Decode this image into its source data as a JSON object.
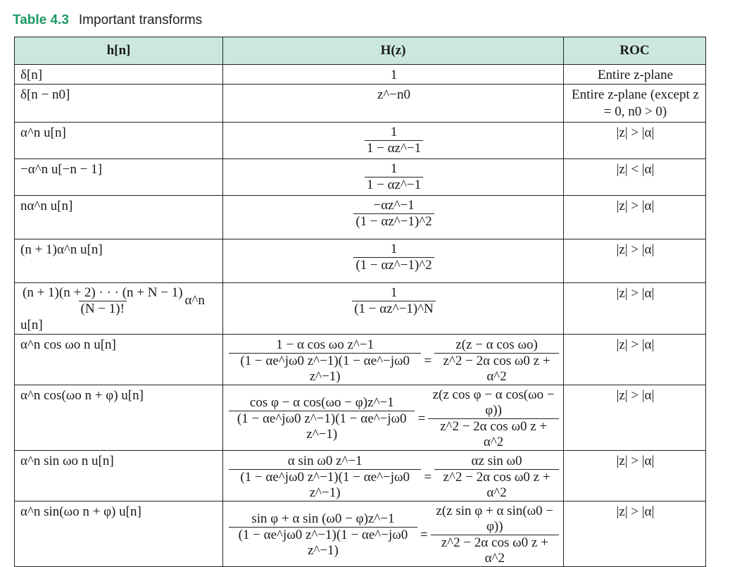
{
  "caption": {
    "number": "Table 4.3",
    "title": "Important transforms"
  },
  "headers": {
    "h": "h[n]",
    "H": "H(z)",
    "roc": "ROC"
  },
  "rows": [
    {
      "h": "δ[n]",
      "H": "1",
      "roc": "Entire z-plane"
    },
    {
      "h": "δ[n − n0]",
      "H": "z^−n0",
      "roc": "Entire z-plane (except z = 0, n0 > 0)"
    },
    {
      "h": "α^n u[n]",
      "H_num": "1",
      "H_den": "1 − αz^−1",
      "roc": "|z| > |α|"
    },
    {
      "h": "−α^n u[−n − 1]",
      "H_num": "1",
      "H_den": "1 − αz^−1",
      "roc": "|z| < |α|"
    },
    {
      "h": "nα^n u[n]",
      "H_num": "−αz^−1",
      "H_den": "(1 − αz^−1)^2",
      "roc": "|z| > |α|"
    },
    {
      "h": "(n + 1)α^n u[n]",
      "H_num": "1",
      "H_den": "(1 − αz^−1)^2",
      "roc": "|z| > |α|"
    },
    {
      "h_num": "(n + 1)(n + 2) · · · (n + N − 1)",
      "h_den": "(N − 1)!",
      "h_tail": "α^n u[n]",
      "H_num": "1",
      "H_den": "(1 − αz^−1)^N",
      "roc": "|z| > |α|"
    },
    {
      "h": "α^n cos ωo n u[n]",
      "H1_num": "1 − α cos ωo z^−1",
      "H1_den": "(1 − αe^jω0 z^−1)(1 − αe^−jω0 z^−1)",
      "H2_num": "z(z − α cos ωo)",
      "H2_den": "z^2 − 2α cos ω0 z + α^2",
      "roc": "|z| > |α|"
    },
    {
      "h": "α^n cos(ωo n + φ) u[n]",
      "H1_num": "cos φ − α cos(ωo − φ)z^−1",
      "H1_den": "(1 − αe^jω0 z^−1)(1 − αe^−jω0 z^−1)",
      "H2_num": "z(z cos φ − α cos(ωo − φ))",
      "H2_den": "z^2 − 2α cos ω0 z + α^2",
      "roc": "|z| > |α|"
    },
    {
      "h": "α^n sin ωo n u[n]",
      "H1_num": "α sin ω0 z^−1",
      "H1_den": "(1 − αe^jω0 z^−1)(1 − αe^−jω0 z^−1)",
      "H2_num": "αz sin ω0",
      "H2_den": "z^2 − 2α cos ω0 z + α^2",
      "roc": "|z| > |α|"
    },
    {
      "h": "α^n sin(ωo n + φ) u[n]",
      "H1_num": "sin φ + α sin (ω0 − φ)z^−1",
      "H1_den": "(1 − αe^jω0 z^−1)(1 − αe^−jω0 z^−1)",
      "H2_num": "z(z sin φ + α sin(ω0 − φ))",
      "H2_den": "z^2 − 2α cos ω0 z + α^2",
      "roc": "|z| > |α|"
    }
  ]
}
